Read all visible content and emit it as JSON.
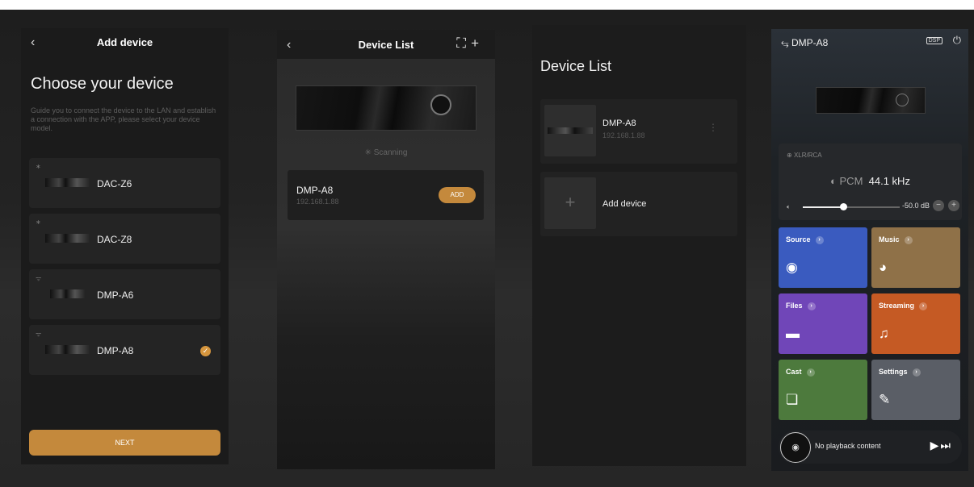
{
  "screen1": {
    "back": "‹",
    "title": "Add device",
    "heading": "Choose your device",
    "description": "Guide you to connect the device to the LAN and establish a connection with the APP, please select your device model.",
    "devices": [
      {
        "name": "DAC-Z6",
        "icon": "bluetooth-icon",
        "glyph": "∗"
      },
      {
        "name": "DAC-Z8",
        "icon": "bluetooth-icon",
        "glyph": "∗"
      },
      {
        "name": "DMP-A6",
        "icon": "wifi-icon",
        "glyph": "ᯤ"
      },
      {
        "name": "DMP-A8",
        "icon": "wifi-icon",
        "glyph": "ᯤ",
        "selected": true
      }
    ],
    "check": "✓",
    "next_label": "NEXT"
  },
  "screen2": {
    "back": "‹",
    "title": "Device List",
    "header_icons": "⛶+",
    "scanning": "Scanning",
    "device": {
      "name": "DMP-A8",
      "ip": "192.168.1.88"
    },
    "add_label": "ADD"
  },
  "screen3": {
    "title": "Device List",
    "device": {
      "name": "DMP-A8",
      "ip": "192.168.1.88"
    },
    "more": "⋮",
    "add_device": "Add device",
    "plus": "+"
  },
  "screen4": {
    "title": "DMP-A8",
    "menu_glyph": "⥃",
    "dsp": "DSP",
    "power": "⏻",
    "source": "XLR/RCA",
    "format": "PCM",
    "rate": "44.1 kHz",
    "volume_db": "-50.0 dB",
    "volume_level": 0.42,
    "minus": "−",
    "plus": "+",
    "tiles": [
      {
        "label": "Source",
        "color": "#3a5bbf",
        "glyph": "◉"
      },
      {
        "label": "Music",
        "color": "#8f7148",
        "glyph": "◕"
      },
      {
        "label": "Files",
        "color": "#7046b8",
        "glyph": "▬"
      },
      {
        "label": "Streaming",
        "color": "#c55a24",
        "glyph": "♫"
      },
      {
        "label": "Cast",
        "color": "#4d7a3d",
        "glyph": "❏"
      },
      {
        "label": "Settings",
        "color": "#5a5e66",
        "glyph": "✎"
      }
    ],
    "arrow": "›",
    "now_playing": "No playback content",
    "controls": "▶⏭"
  }
}
